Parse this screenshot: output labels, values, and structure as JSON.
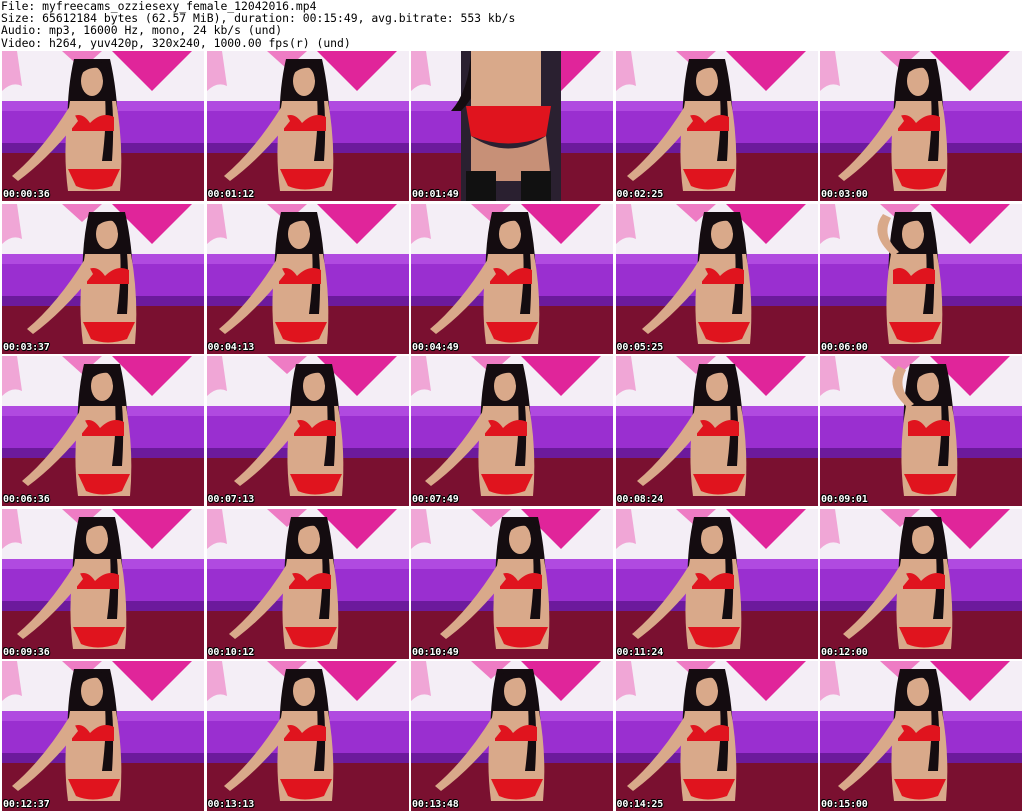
{
  "header": {
    "file": "File: myfreecams_ozziesexy_female_12042016.mp4",
    "size": "Size: 65612184 bytes (62.57 MiB), duration: 00:15:49, avg.bitrate: 553 kb/s",
    "audio": "Audio: mp3, 16000 Hz, mono, 24 kb/s (und)",
    "video": "Video: h264, yuv420p, 320x240, 1000.00 fps(r) (und)"
  },
  "thumbnails": [
    {
      "timestamp": "00:00:36",
      "pose": "seated"
    },
    {
      "timestamp": "00:01:12",
      "pose": "seated"
    },
    {
      "timestamp": "00:01:49",
      "pose": "back"
    },
    {
      "timestamp": "00:02:25",
      "pose": "seated"
    },
    {
      "timestamp": "00:03:00",
      "pose": "seated"
    },
    {
      "timestamp": "00:03:37",
      "pose": "seated"
    },
    {
      "timestamp": "00:04:13",
      "pose": "seated"
    },
    {
      "timestamp": "00:04:49",
      "pose": "standing"
    },
    {
      "timestamp": "00:05:25",
      "pose": "seated"
    },
    {
      "timestamp": "00:06:00",
      "pose": "arm-up"
    },
    {
      "timestamp": "00:06:36",
      "pose": "seated"
    },
    {
      "timestamp": "00:07:13",
      "pose": "seated"
    },
    {
      "timestamp": "00:07:49",
      "pose": "seated"
    },
    {
      "timestamp": "00:08:24",
      "pose": "seated"
    },
    {
      "timestamp": "00:09:01",
      "pose": "arm-up"
    },
    {
      "timestamp": "00:09:36",
      "pose": "seated"
    },
    {
      "timestamp": "00:10:12",
      "pose": "seated"
    },
    {
      "timestamp": "00:10:49",
      "pose": "seated"
    },
    {
      "timestamp": "00:11:24",
      "pose": "seated"
    },
    {
      "timestamp": "00:12:00",
      "pose": "seated"
    },
    {
      "timestamp": "00:12:37",
      "pose": "seated"
    },
    {
      "timestamp": "00:13:13",
      "pose": "seated"
    },
    {
      "timestamp": "00:13:48",
      "pose": "seated"
    },
    {
      "timestamp": "00:14:25",
      "pose": "seated"
    },
    {
      "timestamp": "00:15:00",
      "pose": "seated"
    }
  ],
  "colors": {
    "wall": "#f4eef6",
    "banner": "#e0259a",
    "couch": "#9a2fd0",
    "couch_dark": "#6c1a9c",
    "floor": "#7a1030",
    "lingerie": "#e0141e",
    "hair": "#140c10",
    "skin": "#d9a98a"
  }
}
